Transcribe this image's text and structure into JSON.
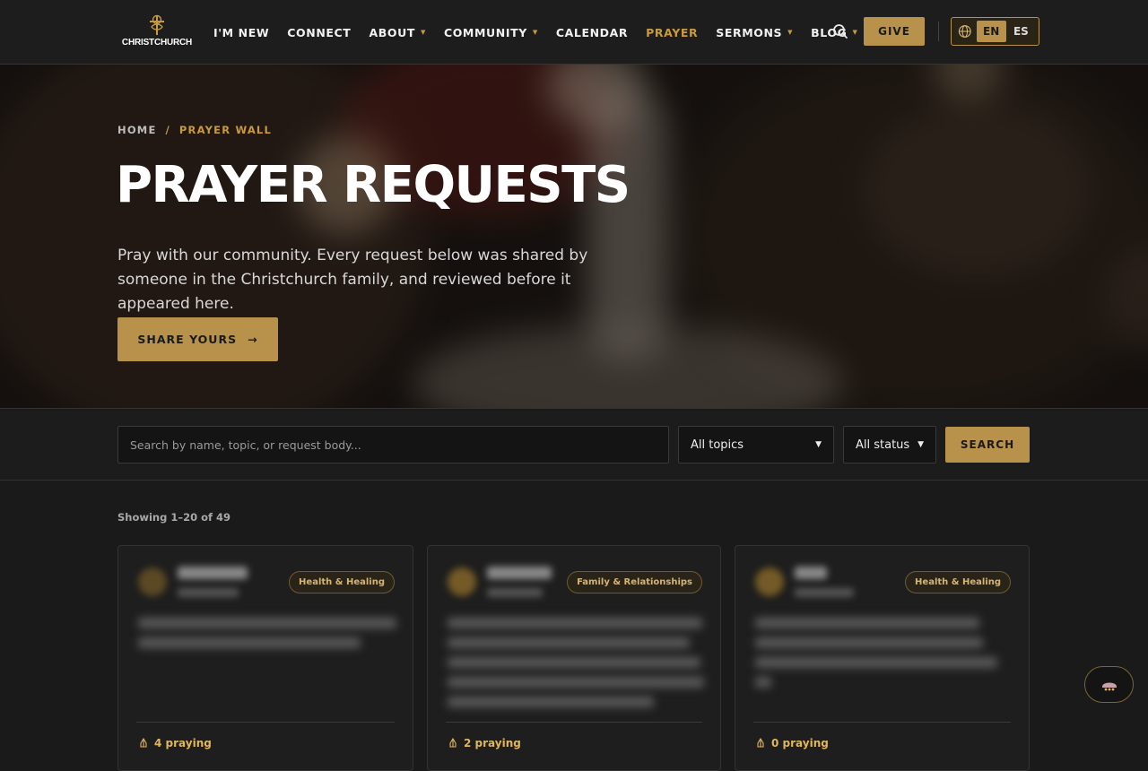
{
  "header": {
    "logo_text": "CHRISTCHURCH",
    "nav": [
      {
        "label": "I'M NEW",
        "caret": false,
        "active": false
      },
      {
        "label": "CONNECT",
        "caret": false,
        "active": false
      },
      {
        "label": "ABOUT",
        "caret": true,
        "active": false
      },
      {
        "label": "COMMUNITY",
        "caret": true,
        "active": false
      },
      {
        "label": "CALENDAR",
        "caret": false,
        "active": false
      },
      {
        "label": "PRAYER",
        "caret": false,
        "active": true
      },
      {
        "label": "SERMONS",
        "caret": true,
        "active": false
      },
      {
        "label": "BLOG",
        "caret": true,
        "active": false
      }
    ],
    "give_label": "GIVE",
    "lang": {
      "en": "EN",
      "es": "ES",
      "selected": "EN"
    }
  },
  "hero": {
    "breadcrumb": {
      "home": "HOME",
      "separator": "/",
      "current": "PRAYER WALL"
    },
    "title": "PRAYER REQUESTS",
    "subtitle": "Pray with our community. Every request below was shared by someone in the Christchurch family, and reviewed before it appeared here.",
    "share_label": "SHARE YOURS",
    "share_arrow": "→"
  },
  "filters": {
    "search_placeholder": "Search by name, topic, or request body...",
    "topics_value": "All topics",
    "status_value": "All status",
    "search_label": "SEARCH"
  },
  "results": {
    "showing": "Showing 1–20 of 49",
    "cards": [
      {
        "topic": "Health & Healing",
        "praying": "4 praying"
      },
      {
        "topic": "Family & Relationships",
        "praying": "2 praying"
      },
      {
        "topic": "Health & Healing",
        "praying": "0 praying"
      }
    ]
  },
  "colors": {
    "accent": "#b8914a",
    "accent_text": "#c99a3c",
    "background": "#1a1a1a"
  },
  "icons": {
    "search": "search-icon",
    "globe": "globe-icon",
    "arrow": "arrow-right-icon",
    "praying": "praying-hands-icon",
    "chat": "chat-icon"
  }
}
